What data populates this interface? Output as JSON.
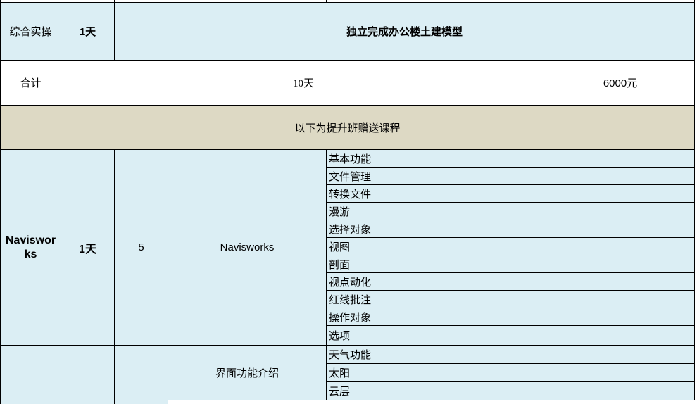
{
  "rows": {
    "practice": {
      "category": "综合实操",
      "duration": "1天",
      "content": "独立完成办公楼土建模型"
    },
    "total": {
      "label": "合计",
      "days": "10天",
      "price": "6000元"
    },
    "bonus_header": "以下为提升班赠送课程",
    "navisworks": {
      "category": "Navisworks",
      "duration": "1天",
      "hours": "5",
      "module": "Navisworks",
      "topics": [
        "基本功能",
        "文件管理",
        "转换文件",
        "漫游",
        "选择对象",
        "视图",
        "剖面",
        "视点动化",
        "红线批注",
        "操作对象",
        "选项"
      ]
    },
    "next": {
      "module": "界面功能介绍",
      "topics": [
        "天气功能",
        "太阳",
        "云层"
      ]
    }
  }
}
